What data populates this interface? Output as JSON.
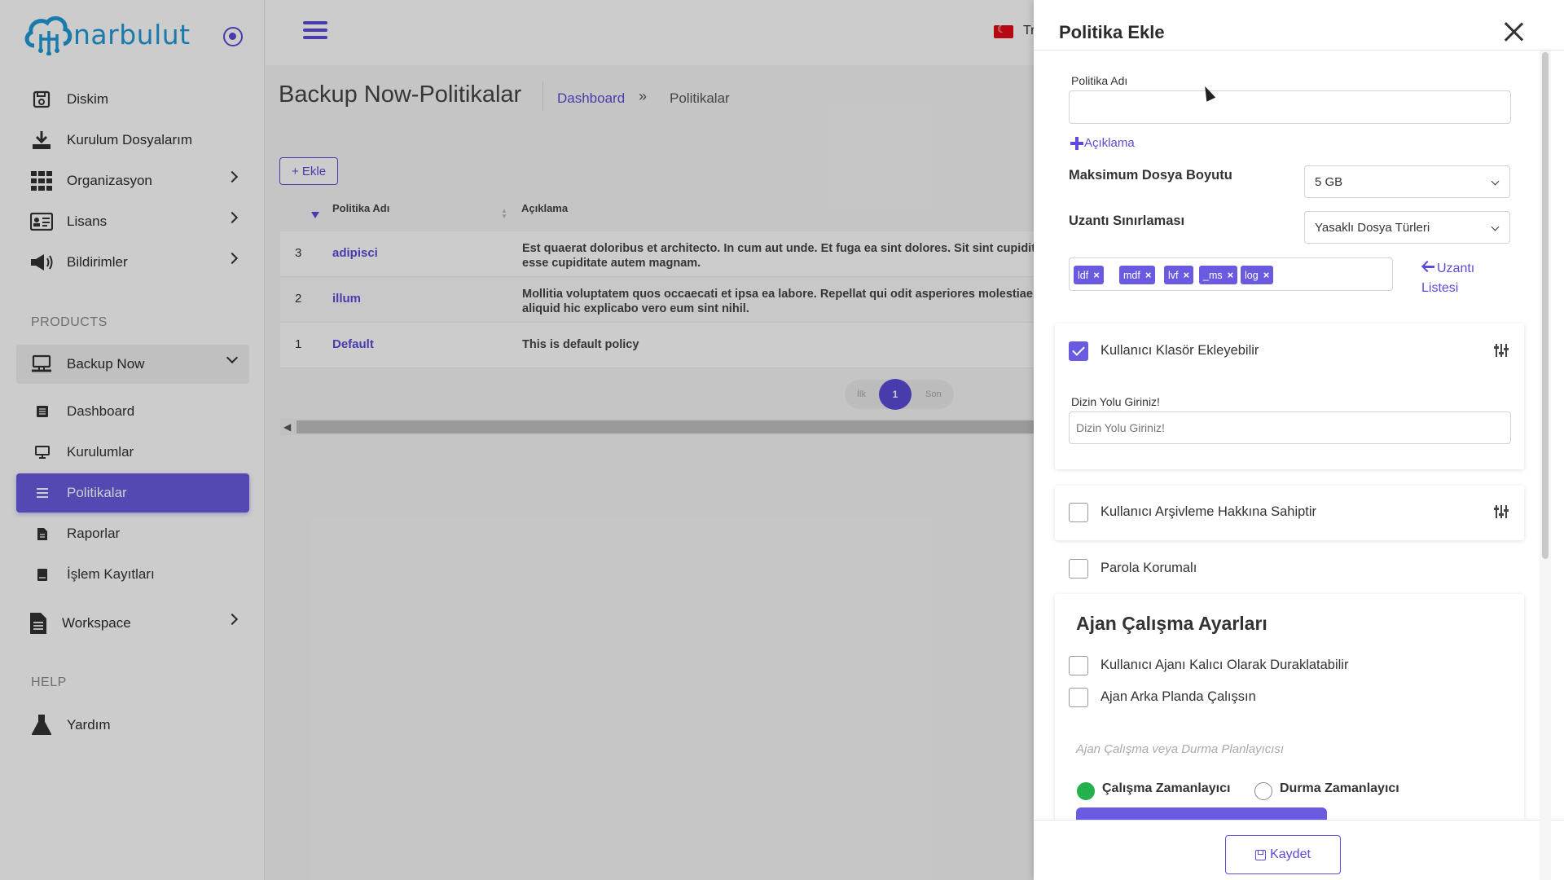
{
  "app": {
    "brand": "narbulut",
    "brand_color": "#1e9ad6",
    "accent": "#5b4bd8"
  },
  "sidebar": {
    "items": [
      {
        "label": "Diskim",
        "icon": "disk-icon"
      },
      {
        "label": "Kurulum Dosyalarım",
        "icon": "download-icon"
      },
      {
        "label": "Organizasyon",
        "icon": "grid-icon"
      },
      {
        "label": "Lisans",
        "icon": "id-card-icon"
      },
      {
        "label": "Bildirimler",
        "icon": "megaphone-icon"
      }
    ],
    "products_title": "PRODUCTS",
    "backup_now": "Backup Now",
    "sub_items": [
      {
        "label": "Dashboard",
        "icon": "list-icon"
      },
      {
        "label": "Kurulumlar",
        "icon": "monitor-icon"
      },
      {
        "label": "Politikalar",
        "icon": "list-icon"
      },
      {
        "label": "Raporlar",
        "icon": "file-icon"
      },
      {
        "label": "İşlem Kayıtları",
        "icon": "book-icon"
      }
    ],
    "workspace": "Workspace",
    "help_title": "HELP",
    "help_item": "Yardım"
  },
  "topbar": {
    "lang": "Tr"
  },
  "page": {
    "title": "Backup Now-Politikalar",
    "breadcrumb_home": "Dashboard",
    "breadcrumb_sep": "»",
    "breadcrumb_current": "Politikalar",
    "add_label": "+ Ekle"
  },
  "table": {
    "columns": [
      "Politika Adı",
      "Açıklama"
    ],
    "rows": [
      {
        "num": "3",
        "name": "adipisci",
        "desc1": "Est quaerat doloribus et architecto. In cum aut unde. Et fuga ea sint dolores. Sit sint cupidita",
        "desc2": "esse cupiditate autem magnam."
      },
      {
        "num": "2",
        "name": "illum",
        "desc1": "Mollitia voluptatem quos occaecati et ipsa ea labore. Repellat qui odit asperiores molestiae.",
        "desc2": "aliquid hic explicabo vero eum sint nihil."
      },
      {
        "num": "1",
        "name": "Default",
        "desc1": "This is default policy",
        "desc2": ""
      }
    ],
    "pager": {
      "first": "İlk",
      "current": "1",
      "last": "Son"
    }
  },
  "drawer": {
    "title": "Politika Ekle",
    "policy_name_label": "Politika Adı",
    "policy_name_value": "",
    "add_description": "Açıklama",
    "max_size_label": "Maksimum Dosya Boyutu",
    "max_size_value": "5 GB",
    "ext_limit_label": "Uzantı Sınırlaması",
    "ext_limit_value": "Yasaklı Dosya Türleri",
    "tags": [
      "ldf",
      "mdf",
      "lvf",
      "_ms",
      "log"
    ],
    "tag_remove": "×",
    "ext_list_line1": "Uzantı",
    "ext_list_line2": "Listesi",
    "folder_checkbox": "Kullanıcı Klasör Ekleyebilir",
    "dir_label": "Dizin Yolu Giriniz!",
    "dir_placeholder": "Dizin Yolu Giriniz!",
    "archive_checkbox": "Kullanıcı Arşivleme Hakkına Sahiptir",
    "password_checkbox": "Parola Korumalı",
    "agent_title": "Ajan Çalışma Ayarları",
    "agent_pause": "Kullanıcı Ajanı Kalıcı Olarak Duraklatabilir",
    "agent_background": "Ajan Arka Planda Çalışsın",
    "scheduler_placeholder": "Ajan Çalışma veya Durma Planlayıcısı",
    "radio_run": "Çalışma Zamanlayıcı",
    "radio_stop": "Durma Zamanlayıcı",
    "save": "Kaydet"
  }
}
